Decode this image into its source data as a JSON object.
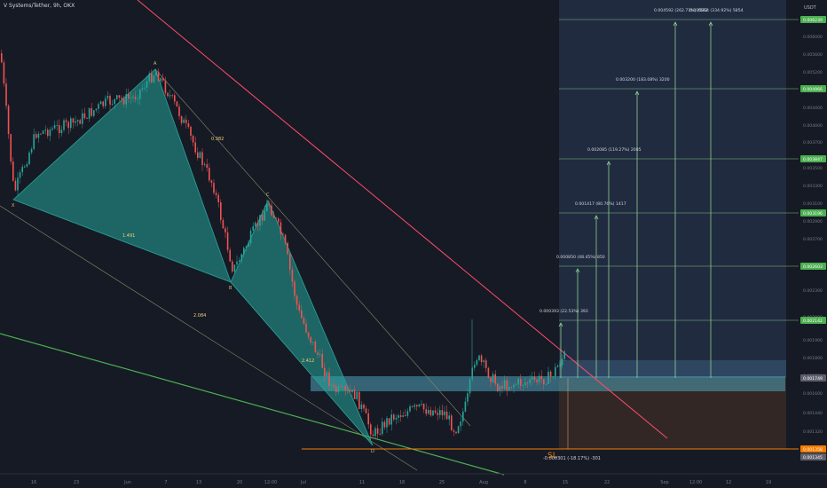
{
  "title": "V Systems/Tether, 9h, OKX",
  "currency": "USDT",
  "chart_data": {
    "type": "candlestick",
    "x_ticks": [
      "16",
      "23",
      "Jun",
      "7",
      "13",
      "20",
      "12:00",
      "Jul",
      "11",
      "18",
      "25",
      "Aug",
      "8",
      "15",
      "22",
      "Sep",
      "12:00",
      "12",
      "19"
    ],
    "y_ticks": [
      "0.006000",
      "0.005600",
      "0.005200",
      "0.004800",
      "0.004400",
      "0.004000",
      "0.003700",
      "0.003500",
      "0.003300",
      "0.003100",
      "0.002900",
      "0.002700",
      "0.002450",
      "0.002300",
      "0.002000",
      "0.001900",
      "0.001800",
      "0.001700",
      "0.001600",
      "0.001440",
      "0.001320",
      "0.001215"
    ],
    "price_badges": [
      {
        "value": "0.006239",
        "color": "#4caf50"
      },
      {
        "value": "0.004966",
        "color": "#4caf50"
      },
      {
        "value": "0.003847",
        "color": "#4caf50"
      },
      {
        "value": "0.003196",
        "color": "#4caf50"
      },
      {
        "value": "0.002603",
        "color": "#4caf50"
      },
      {
        "value": "0.002142",
        "color": "#4caf50"
      },
      {
        "value": "0.001749",
        "color": "#5d606b"
      },
      {
        "value": "0.001358",
        "color": "#f57c00"
      },
      {
        "value": "0.001345",
        "color": "#5d606b"
      }
    ],
    "harmonic_points": [
      {
        "label": "X",
        "x": 15,
        "y": 225
      },
      {
        "label": "A",
        "x": 175,
        "y": 78
      },
      {
        "label": "B",
        "x": 260,
        "y": 318
      },
      {
        "label": "C",
        "x": 302,
        "y": 226
      },
      {
        "label": "D",
        "x": 420,
        "y": 502
      }
    ],
    "ratios": [
      {
        "text": "0.382",
        "x": 238,
        "y": 158
      },
      {
        "text": "1.491",
        "x": 138,
        "y": 267
      },
      {
        "text": "2.084",
        "x": 218,
        "y": 357
      },
      {
        "text": "2.412",
        "x": 340,
        "y": 408
      }
    ],
    "targets": [
      {
        "label": "0.000393 (22.53%) 393",
        "y": 361,
        "x": 632
      },
      {
        "label": "0.000850 (48.45%) 850",
        "y": 300,
        "x": 651
      },
      {
        "label": "0.001417 (80.76%) 1417",
        "y": 240,
        "x": 672
      },
      {
        "label": "0.002085 (119.27%) 2085",
        "y": 179,
        "x": 686
      },
      {
        "label": "0.003200 (183.08%) 3200",
        "y": 100,
        "x": 718
      },
      {
        "label": "0.004592 (262.71%) 4592",
        "y": 22,
        "x": 761
      },
      {
        "label": "0.005854 (334.92%) 5854",
        "y": 22,
        "x": 801
      }
    ],
    "stop_label": "-0.000301 (-18.17%) -301",
    "stop_badge": "SL"
  }
}
